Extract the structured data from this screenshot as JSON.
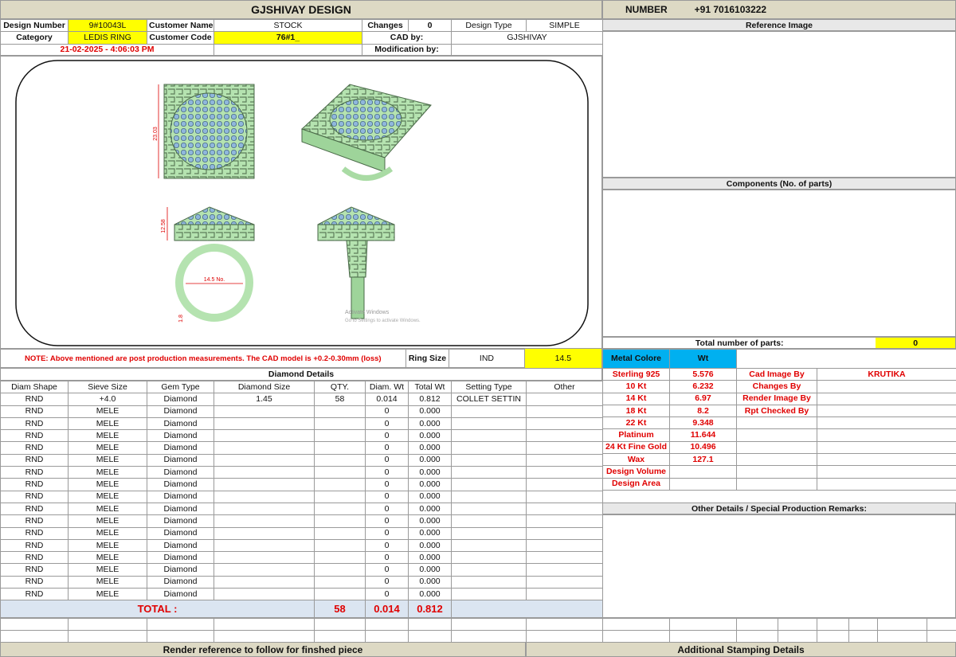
{
  "title": "GJSHIVAY DESIGN",
  "number_label": "NUMBER",
  "number_value": "+91 7016103222",
  "header": {
    "design_number_label": "Design Number",
    "design_number": "9#10043L",
    "customer_name_label": "Customer Name",
    "customer_name": "STOCK",
    "changes_label": "Changes",
    "changes": "0",
    "design_type_label": "Design Type",
    "design_type": "SIMPLE",
    "category_label": "Category",
    "category": "LEDIS RING",
    "customer_code_label": "Customer Code",
    "customer_code": "76#1_",
    "cad_by_label": "CAD by:",
    "cad_by": "GJSHIVAY",
    "date": "21-02-2025 - 4:06:03 PM",
    "modification_label": "Modification by:",
    "modification": ""
  },
  "drawing": {
    "dim_width": "23.03",
    "dim_height": "12.58",
    "dim_ring": "14.5 No.",
    "dim_band": "1.8",
    "watermark_line1": "Activate Windows",
    "watermark_line2": "Go to Settings to activate Windows."
  },
  "right_panel": {
    "reference_image": "Reference Image",
    "components": "Components (No. of parts)",
    "total_parts_label": "Total number of parts:",
    "total_parts": "0"
  },
  "note": "NOTE: Above mentioned are post production measurements. The CAD model is +0.2-0.30mm (loss)",
  "ring_size_label": "Ring Size",
  "ring_size_unit": "IND",
  "ring_size": "14.5",
  "metal_header": {
    "colour": "Metal Colore",
    "wt": "Wt"
  },
  "metals": [
    {
      "name": "Sterling 925",
      "wt": "5.576",
      "meta_label": "Cad Image By",
      "meta_value": "KRUTIKA"
    },
    {
      "name": "10 Kt",
      "wt": "6.232",
      "meta_label": "Changes By",
      "meta_value": ""
    },
    {
      "name": "14 Kt",
      "wt": "6.97",
      "meta_label": "Render Image By",
      "meta_value": ""
    },
    {
      "name": "18 Kt",
      "wt": "8.2",
      "meta_label": "Rpt Checked By",
      "meta_value": ""
    },
    {
      "name": "22 Kt",
      "wt": "9.348",
      "meta_label": "",
      "meta_value": ""
    },
    {
      "name": "Platinum",
      "wt": "11.644",
      "meta_label": "",
      "meta_value": ""
    },
    {
      "name": "24 Kt Fine Gold",
      "wt": "10.496",
      "meta_label": "",
      "meta_value": ""
    },
    {
      "name": "Wax",
      "wt": "127.1",
      "meta_label": "",
      "meta_value": ""
    },
    {
      "name": "Design Volume",
      "wt": "",
      "meta_label": "",
      "meta_value": ""
    },
    {
      "name": "Design Area",
      "wt": "",
      "meta_label": "",
      "meta_value": ""
    }
  ],
  "other_details": "Other Details / Special Production Remarks:",
  "diamond": {
    "title": "Diamond Details",
    "columns": [
      "Diam Shape",
      "Sieve Size",
      "Gem Type",
      "Diamond Size",
      "QTY.",
      "Diam. Wt",
      "Total Wt",
      "Setting Type",
      "Other"
    ],
    "rows": [
      [
        "RND",
        "+4.0",
        "Diamond",
        "1.45",
        "58",
        "0.014",
        "0.812",
        "COLLET SETTIN",
        ""
      ],
      [
        "RND",
        "MELE",
        "Diamond",
        "",
        "",
        "0",
        "0.000",
        "",
        ""
      ],
      [
        "RND",
        "MELE",
        "Diamond",
        "",
        "",
        "0",
        "0.000",
        "",
        ""
      ],
      [
        "RND",
        "MELE",
        "Diamond",
        "",
        "",
        "0",
        "0.000",
        "",
        ""
      ],
      [
        "RND",
        "MELE",
        "Diamond",
        "",
        "",
        "0",
        "0.000",
        "",
        ""
      ],
      [
        "RND",
        "MELE",
        "Diamond",
        "",
        "",
        "0",
        "0.000",
        "",
        ""
      ],
      [
        "RND",
        "MELE",
        "Diamond",
        "",
        "",
        "0",
        "0.000",
        "",
        ""
      ],
      [
        "RND",
        "MELE",
        "Diamond",
        "",
        "",
        "0",
        "0.000",
        "",
        ""
      ],
      [
        "RND",
        "MELE",
        "Diamond",
        "",
        "",
        "0",
        "0.000",
        "",
        ""
      ],
      [
        "RND",
        "MELE",
        "Diamond",
        "",
        "",
        "0",
        "0.000",
        "",
        ""
      ],
      [
        "RND",
        "MELE",
        "Diamond",
        "",
        "",
        "0",
        "0.000",
        "",
        ""
      ],
      [
        "RND",
        "MELE",
        "Diamond",
        "",
        "",
        "0",
        "0.000",
        "",
        ""
      ],
      [
        "RND",
        "MELE",
        "Diamond",
        "",
        "",
        "0",
        "0.000",
        "",
        ""
      ],
      [
        "RND",
        "MELE",
        "Diamond",
        "",
        "",
        "0",
        "0.000",
        "",
        ""
      ],
      [
        "RND",
        "MELE",
        "Diamond",
        "",
        "",
        "0",
        "0.000",
        "",
        ""
      ],
      [
        "RND",
        "MELE",
        "Diamond",
        "",
        "",
        "0",
        "0.000",
        "",
        ""
      ],
      [
        "RND",
        "MELE",
        "Diamond",
        "",
        "",
        "0",
        "0.000",
        "",
        ""
      ]
    ],
    "total_label": "TOTAL :",
    "total_qty": "58",
    "total_diam_wt": "0.014",
    "total_wt": "0.812"
  },
  "footer": {
    "render_ref": "Render reference to follow for finshed piece",
    "stamping": "Additional Stamping Details"
  }
}
